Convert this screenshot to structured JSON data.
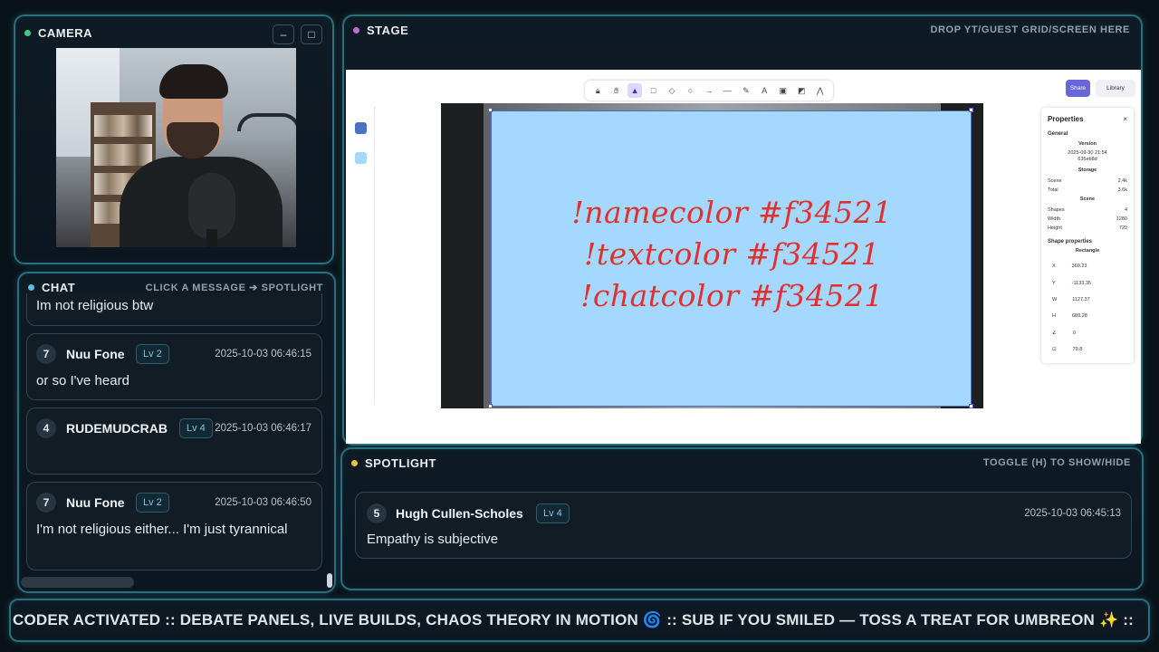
{
  "camera": {
    "title": "CAMERA",
    "minimize_label": "–",
    "maximize_label": "□",
    "dot_color": "#3ec98a"
  },
  "chat": {
    "title": "CHAT",
    "hint": "CLICK A MESSAGE ➔ SPOTLIGHT",
    "dot_color": "#5bc0de",
    "partial_message": "Im not religious btw",
    "messages": [
      {
        "num": "7",
        "user": "Nuu Fone",
        "level": "Lv 2",
        "time": "2025-10-03 06:46:15",
        "text": "or so I've heard"
      },
      {
        "num": "4",
        "user": "RUDEMUDCRAB",
        "level": "Lv 4",
        "time": "2025-10-03 06:46:17",
        "text": ""
      },
      {
        "num": "7",
        "user": "Nuu Fone",
        "level": "Lv 2",
        "time": "2025-10-03 06:46:50",
        "text": "I'm not religious either... I'm just tyrannical"
      }
    ]
  },
  "stage": {
    "title": "STAGE",
    "hint": "DROP YT/GUEST GRID/SCREEN HERE",
    "dot_color": "#c36ad8",
    "share_label": "Share",
    "library_label": "Library",
    "commands": [
      "!namecolor #f34521",
      "!textcolor #f34521",
      "!chatcolor #f34521"
    ],
    "swatches": [
      "#4a72c4",
      "#a5d8ff"
    ],
    "text_color": "#e03131",
    "rect_color": "#a5d8ff",
    "properties": {
      "title": "Properties",
      "general": "General",
      "version_label": "Version",
      "version_value": "2025-09-30 21:54",
      "version_hash": "635eb8d",
      "storage_label": "Storage",
      "scene_storage_label": "Scene",
      "scene_storage_value": "2.4k",
      "total_label": "Total",
      "total_value": "3.6k",
      "scene_label": "Scene",
      "shapes_label": "Shapes",
      "shapes_value": "4",
      "width_label": "Width",
      "width_value": "1280",
      "height_label": "Height",
      "height_value": "720",
      "shape_props": "Shape properties",
      "shape_type": "Rectangle",
      "x_label": "X",
      "x_value": "369.23",
      "y_label": "Y",
      "y_value": "-1133.35",
      "w_label": "W",
      "w_value": "1127.37",
      "h_label": "H",
      "h_value": "689.28",
      "angle_label": "∠",
      "angle_value": "0",
      "opacity_label": "⊡",
      "opacity_value": "79.8"
    }
  },
  "spotlight": {
    "title": "SPOTLIGHT",
    "hint": "TOGGLE (H) TO SHOW/HIDE",
    "dot_color": "#e8c23a",
    "message": {
      "num": "5",
      "user": "Hugh Cullen-Scholes",
      "level": "Lv 4",
      "time": "2025-10-03 06:45:13",
      "text": "Empathy is subjective"
    }
  },
  "ticker": {
    "text": "CODER ACTIVATED :: DEBATE PANELS, LIVE BUILDS, CHAOS THEORY IN MOTION 🌀 :: SUB IF YOU SMILED — TOSS A TREAT FOR UMBREON ✨ ::"
  }
}
